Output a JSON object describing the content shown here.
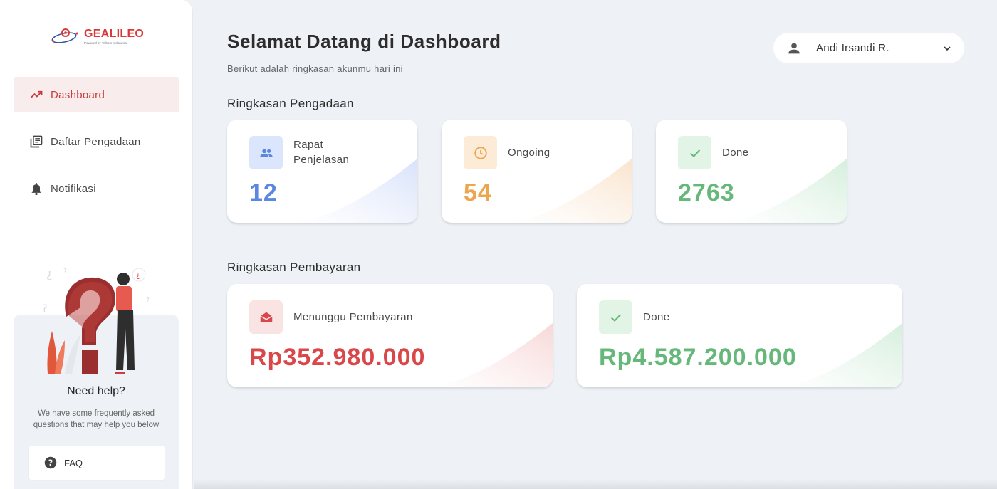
{
  "brand": {
    "name": "GEALILEO",
    "tagline": "Powered by Telkom Indonesia",
    "color": "#d83a3a"
  },
  "sidebar": {
    "items": [
      {
        "label": "Dashboard",
        "icon": "trending-up-icon",
        "active": true
      },
      {
        "label": "Daftar Pengadaan",
        "icon": "library-books-icon",
        "active": false
      },
      {
        "label": "Notifikasi",
        "icon": "bell-icon",
        "active": false
      }
    ],
    "help": {
      "title": "Need help?",
      "description": "We have some frequently asked questions that may help you below",
      "faq_label": "FAQ"
    }
  },
  "header": {
    "title": "Selamat Datang di Dashboard",
    "subtitle": "Berikut adalah ringkasan akunmu hari ini",
    "user": {
      "name": "Andi Irsandi R."
    }
  },
  "pengadaan": {
    "title": "Ringkasan Pengadaan",
    "cards": [
      {
        "label": "Rapat Penjelasan",
        "value": "12",
        "icon": "people-icon",
        "color": "#5b87e0"
      },
      {
        "label": "Ongoing",
        "value": "54",
        "icon": "clock-icon",
        "color": "#eea54f"
      },
      {
        "label": "Done",
        "value": "2763",
        "icon": "check-icon",
        "color": "#66b87a"
      }
    ]
  },
  "pembayaran": {
    "title": "Ringkasan Pembayaran",
    "cards": [
      {
        "label": "Menunggu Pembayaran",
        "value": "Rp352.980.000",
        "icon": "mail-open-icon",
        "color": "#d9474a"
      },
      {
        "label": "Done",
        "value": "Rp4.587.200.000",
        "icon": "check-icon",
        "color": "#66b87a"
      }
    ]
  }
}
